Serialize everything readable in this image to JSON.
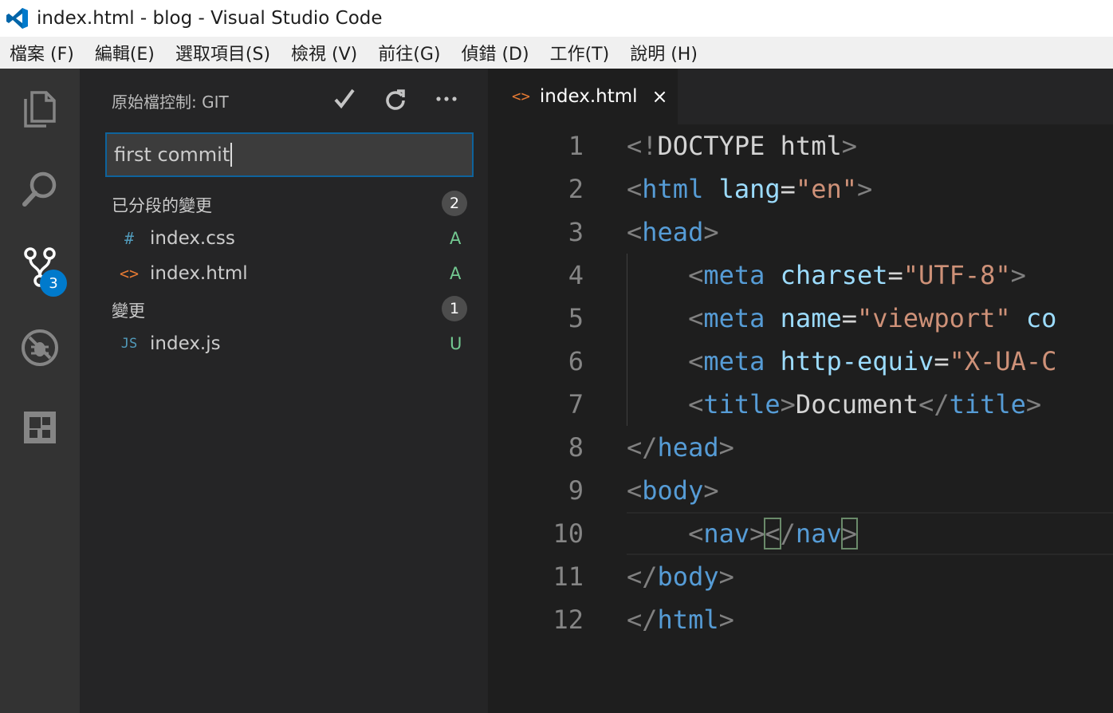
{
  "window": {
    "title": "index.html - blog - Visual Studio Code",
    "app_icon": "vscode-logo-icon"
  },
  "menu": [
    "檔案 (F)",
    "編輯(E)",
    "選取項目(S)",
    "檢視 (V)",
    "前往(G)",
    "偵錯 (D)",
    "工作(T)",
    "說明 (H)"
  ],
  "activity_bar": {
    "items": [
      "explorer-icon",
      "search-icon",
      "source-control-icon",
      "debug-icon",
      "extensions-icon"
    ],
    "scm_badge": "3",
    "badge_color": "#007acc"
  },
  "sidebar": {
    "title": "原始檔控制: GIT",
    "actions": [
      "commit-check-icon",
      "refresh-icon",
      "more-icon"
    ],
    "commit_message": "first commit",
    "staged": {
      "label": "已分段的變更",
      "count": "2",
      "files": [
        {
          "icon": "#",
          "name": "index.css",
          "status": "A",
          "icon_color": "#519aba"
        },
        {
          "icon": "<>",
          "name": "index.html",
          "status": "A",
          "icon_color": "#e37933"
        }
      ]
    },
    "changes": {
      "label": "變更",
      "count": "1",
      "files": [
        {
          "icon": "JS",
          "name": "index.js",
          "status": "U",
          "icon_color": "#519aba"
        }
      ]
    }
  },
  "editor": {
    "tab": {
      "label": "index.html",
      "icon": "<>",
      "close": "×"
    },
    "line_numbers": [
      "1",
      "2",
      "3",
      "4",
      "5",
      "6",
      "7",
      "8",
      "9",
      "10",
      "11",
      "12"
    ],
    "lines": [
      [
        [
          "punc",
          "<"
        ],
        [
          "punc",
          "!"
        ],
        [
          "text",
          "DOCTYPE html"
        ],
        [
          "punc",
          ">"
        ]
      ],
      [
        [
          "punc",
          "<"
        ],
        [
          "tag",
          "html"
        ],
        [
          "text",
          " "
        ],
        [
          "attr",
          "lang"
        ],
        [
          "text",
          "="
        ],
        [
          "str",
          "\"en\""
        ],
        [
          "punc",
          ">"
        ]
      ],
      [
        [
          "punc",
          "<"
        ],
        [
          "tag",
          "head"
        ],
        [
          "punc",
          ">"
        ]
      ],
      [
        [
          "text",
          "    "
        ],
        [
          "punc",
          "<"
        ],
        [
          "tag",
          "meta"
        ],
        [
          "text",
          " "
        ],
        [
          "attr",
          "charset"
        ],
        [
          "text",
          "="
        ],
        [
          "str",
          "\"UTF-8\""
        ],
        [
          "punc",
          ">"
        ]
      ],
      [
        [
          "text",
          "    "
        ],
        [
          "punc",
          "<"
        ],
        [
          "tag",
          "meta"
        ],
        [
          "text",
          " "
        ],
        [
          "attr",
          "name"
        ],
        [
          "text",
          "="
        ],
        [
          "str",
          "\"viewport\""
        ],
        [
          "text",
          " "
        ],
        [
          "attr",
          "co"
        ]
      ],
      [
        [
          "text",
          "    "
        ],
        [
          "punc",
          "<"
        ],
        [
          "tag",
          "meta"
        ],
        [
          "text",
          " "
        ],
        [
          "attr",
          "http-equiv"
        ],
        [
          "text",
          "="
        ],
        [
          "str",
          "\"X-UA-C"
        ]
      ],
      [
        [
          "text",
          "    "
        ],
        [
          "punc",
          "<"
        ],
        [
          "tag",
          "title"
        ],
        [
          "punc",
          ">"
        ],
        [
          "text",
          "Document"
        ],
        [
          "punc",
          "</"
        ],
        [
          "tag",
          "title"
        ],
        [
          "punc",
          ">"
        ]
      ],
      [
        [
          "punc",
          "</"
        ],
        [
          "tag",
          "head"
        ],
        [
          "punc",
          ">"
        ]
      ],
      [
        [
          "punc",
          "<"
        ],
        [
          "tag",
          "body"
        ],
        [
          "punc",
          ">"
        ]
      ],
      [
        [
          "text",
          "    "
        ],
        [
          "punc",
          "<"
        ],
        [
          "tag",
          "nav"
        ],
        [
          "punc",
          ">"
        ],
        [
          "match",
          "<"
        ],
        [
          "punc",
          "/"
        ],
        [
          "tag",
          "nav"
        ],
        [
          "match",
          ">"
        ]
      ],
      [
        [
          "punc",
          "</"
        ],
        [
          "tag",
          "body"
        ],
        [
          "punc",
          ">"
        ]
      ],
      [
        [
          "punc",
          "</"
        ],
        [
          "tag",
          "html"
        ],
        [
          "punc",
          ">"
        ]
      ]
    ]
  }
}
